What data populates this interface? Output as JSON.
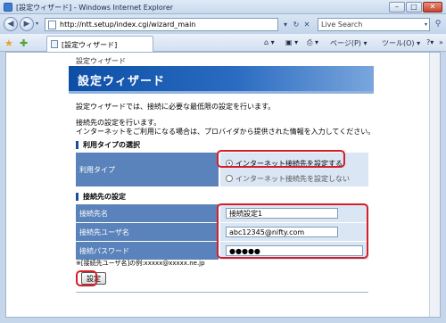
{
  "window": {
    "title": "[設定ウィザード] - Windows Internet Explorer",
    "minimize": "–",
    "maximize": "□",
    "close": "✕"
  },
  "address": {
    "url": "http://ntt.setup/index.cgi/wizard_main",
    "search_placeholder": "Live Search",
    "back": "◀",
    "forward": "▶",
    "refresh": "↻",
    "stop": "✕",
    "search_go": "⚲",
    "dropdown": "▾"
  },
  "tabbar": {
    "tab_label": "[設定ウィザード]",
    "favorites_star": "★",
    "add_favorite": "✚",
    "home": "⌂ ▾",
    "feeds": "▣ ▾",
    "print": "⎙ ▾",
    "page_menu": "ページ(P) ▾",
    "tools_menu": "ツール(O) ▾",
    "help": "?▾",
    "more": "»"
  },
  "page": {
    "breadcrumb": "設定ウィザード",
    "title": "設定ウィザード",
    "intro": "設定ウィザードでは、接続に必要な最低限の設定を行います。",
    "desc1": "接続先の設定を行います。",
    "desc2": "インターネットをご利用になる場合は、プロバイダから提供された情報を入力してください。",
    "section_usage": "利用タイプの選択",
    "usage_label": "利用タイプ",
    "usage_option1": "インターネット接続先を設定する",
    "usage_option2": "インターネット接続先を設定しない",
    "section_conn": "接続先の設定",
    "conn_name_label": "接続先名",
    "conn_name_value": "接続設定1",
    "conn_user_label": "接続先ユーザ名",
    "conn_user_value": "abc12345@nifty.com",
    "conn_pass_label": "接続パスワード",
    "conn_pass_value": "●●●●●",
    "note": "※[接続先ユーザ名]の例:xxxxx@xxxxx.ne.jp",
    "submit_label": "設定"
  },
  "colors": {
    "highlight": "#d41e2a",
    "banner": "#0d4ea6",
    "label_cell": "#5b83bb",
    "value_cell": "#dbe6f4"
  }
}
